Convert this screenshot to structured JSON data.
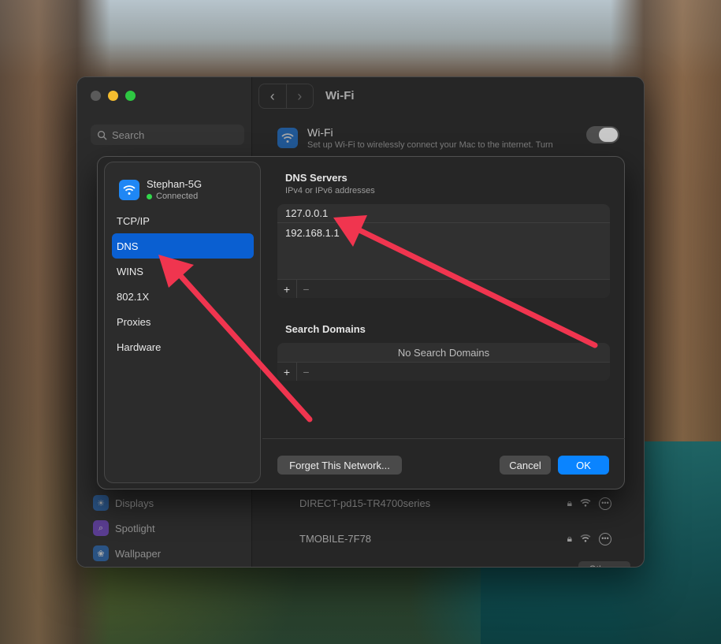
{
  "window": {
    "title": "Wi-Fi",
    "search_placeholder": "Search",
    "nav_back": "‹",
    "nav_forward": "›",
    "wifi_header": {
      "title": "Wi-Fi",
      "description": "Set up Wi-Fi to wirelessly connect your Mac to the internet. Turn"
    },
    "sidebar_items": [
      {
        "label": "Displays",
        "icon": "sun-icon"
      },
      {
        "label": "Spotlight",
        "icon": "magnifier-icon"
      },
      {
        "label": "Wallpaper",
        "icon": "flower-icon"
      }
    ],
    "networks": [
      {
        "name": "DIRECT-pd15-TR4700series"
      },
      {
        "name": "TMOBILE-7F78"
      }
    ],
    "other_button": "Other..."
  },
  "sheet": {
    "network": {
      "name": "Stephan-5G",
      "status": "Connected",
      "status_color": "#32d74b"
    },
    "menu": [
      {
        "label": "TCP/IP",
        "active": false
      },
      {
        "label": "DNS",
        "active": true
      },
      {
        "label": "WINS",
        "active": false
      },
      {
        "label": "802.1X",
        "active": false
      },
      {
        "label": "Proxies",
        "active": false
      },
      {
        "label": "Hardware",
        "active": false
      }
    ],
    "dns": {
      "title": "DNS Servers",
      "subtitle": "IPv4 or IPv6 addresses",
      "servers": [
        "127.0.0.1",
        "192.168.1.1"
      ],
      "add": "+",
      "remove": "−"
    },
    "search_domains": {
      "title": "Search Domains",
      "empty": "No Search Domains",
      "add": "+",
      "remove": "−"
    },
    "buttons": {
      "forget": "Forget This Network...",
      "cancel": "Cancel",
      "ok": "OK"
    }
  },
  "colors": {
    "accent": "#0a84ff",
    "selection": "#0a5fd1",
    "annotation_arrow": "#f0354f"
  }
}
